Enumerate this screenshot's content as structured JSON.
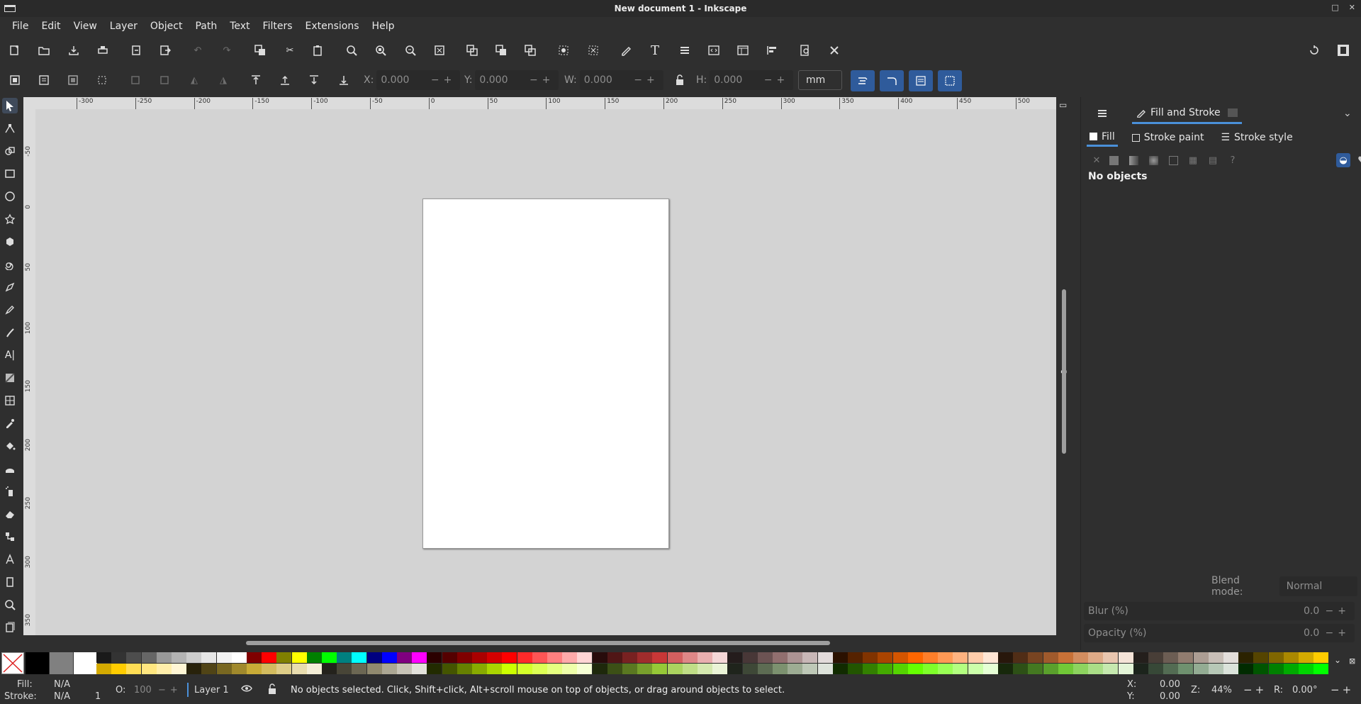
{
  "window": {
    "title": "New document 1 - Inkscape"
  },
  "menu": [
    "File",
    "Edit",
    "View",
    "Layer",
    "Object",
    "Path",
    "Text",
    "Filters",
    "Extensions",
    "Help"
  ],
  "commands_icons": [
    "new-document-icon",
    "open-icon",
    "save-icon",
    "print-icon",
    "import-icon",
    "export-icon",
    "undo-icon",
    "redo-icon",
    "copy-icon",
    "cut-icon",
    "paste-icon",
    "zoom-selection-icon",
    "zoom-drawing-icon",
    "zoom-page-icon",
    "zoom-page-width-icon",
    "duplicate-icon",
    "clone-icon",
    "unlink-clone-icon",
    "group-icon",
    "ungroup-icon",
    "fill-stroke-icon",
    "text-font-icon",
    "layers-icon",
    "xml-editor-icon",
    "document-properties-icon",
    "align-distribute-icon",
    "print-preview-icon",
    "preferences-icon"
  ],
  "select_toolbar": {
    "x_label": "X:",
    "x_value": "0.000",
    "y_label": "Y:",
    "y_value": "0.000",
    "w_label": "W:",
    "w_value": "0.000",
    "h_label": "H:",
    "h_value": "0.000",
    "unit": "mm"
  },
  "tools": [
    "selector",
    "node",
    "shape-builder",
    "rectangle",
    "ellipse",
    "star",
    "3d-box",
    "spiral",
    "bezier",
    "pencil",
    "calligraphy",
    "text",
    "gradient",
    "mesh",
    "dropper",
    "paint-bucket",
    "tweak",
    "spray",
    "eraser",
    "connector",
    "measure",
    "zoom",
    "pages"
  ],
  "ruler": {
    "h_labels": [
      "-300",
      "-250",
      "-200",
      "-150",
      "-100",
      "-50",
      "0",
      "50",
      "100",
      "150",
      "200",
      "250",
      "300",
      "350",
      "400",
      "450",
      "500"
    ],
    "v_labels": [
      "-50",
      "0",
      "50",
      "100",
      "150",
      "200",
      "250",
      "300",
      "350"
    ]
  },
  "dock": {
    "panel_title": "Fill and Stroke",
    "tabs": {
      "fill": "Fill",
      "stroke_paint": "Stroke paint",
      "stroke_style": "Stroke style"
    },
    "no_objects": "No objects",
    "blend_label": "Blend mode:",
    "blend_value": "Normal",
    "blur_label": "Blur (%)",
    "blur_value": "0.0",
    "opacity_label": "Opacity (%)",
    "opacity_value": "0.0"
  },
  "palette": {
    "row1": [
      "#000000",
      "#808080",
      "#ffffff",
      "#1a1a1a",
      "#333333",
      "#4d4d4d",
      "#666666",
      "#999999",
      "#b3b3b3",
      "#cccccc",
      "#e6e6e6",
      "#f2f2f2",
      "#ffffff",
      "#800000",
      "#ff0000",
      "#808000",
      "#ffff00",
      "#008000",
      "#00ff00",
      "#008080",
      "#00ffff",
      "#000080",
      "#0000ff",
      "#800080",
      "#ff00ff",
      "#2b0000",
      "#550000",
      "#800000",
      "#aa0000",
      "#d40000",
      "#ff0000",
      "#ff2a2a",
      "#ff5555",
      "#ff8080",
      "#ffaaaa",
      "#ffd5d5",
      "#280b0b",
      "#501616",
      "#782121",
      "#a02c2c",
      "#c83737",
      "#d35f5f",
      "#de8787",
      "#e9afaf",
      "#f4d7d7",
      "#241c1c",
      "#483737",
      "#6c5353",
      "#916f6f",
      "#ac9393",
      "#c8b7b7",
      "#e3dbdb",
      "#2b1100",
      "#552200",
      "#803300",
      "#aa4400",
      "#d45500",
      "#ff6600",
      "#ff7f2a",
      "#ff9955",
      "#ffb380",
      "#ffccaa",
      "#ffe6d5",
      "#28170b",
      "#502d16",
      "#784421",
      "#a05a2c",
      "#c87137",
      "#d38d5f",
      "#deaa87",
      "#e9c6af",
      "#f4e3d7",
      "#241f1c",
      "#483e37",
      "#6c5d53",
      "#917c6f",
      "#ac9d93",
      "#c8beb7",
      "#e3dedb",
      "#2b2200",
      "#554400",
      "#806600",
      "#aa8800",
      "#d4aa00",
      "#ffcc00"
    ],
    "row2": [
      "#d4aa00",
      "#ffcc00",
      "#ffdd55",
      "#ffe680",
      "#ffeeaa",
      "#fff6d5",
      "#28220b",
      "#504416",
      "#786721",
      "#a0892c",
      "#c8ab37",
      "#d3bc5f",
      "#decd87",
      "#e9ddaf",
      "#f4eed7",
      "#24221c",
      "#484537",
      "#6c6753",
      "#918a6f",
      "#aca793",
      "#c8c4b7",
      "#e3e2db",
      "#222b00",
      "#445500",
      "#668000",
      "#88aa00",
      "#aad400",
      "#ccff00",
      "#d4ff2a",
      "#ddff55",
      "#e5ff80",
      "#eeffaa",
      "#f6ffd5",
      "#1e280b",
      "#3c5016",
      "#5a7821",
      "#78a02c",
      "#96c837",
      "#abd35f",
      "#c0de87",
      "#d5e9af",
      "#eaf4d7",
      "#1f241c",
      "#3e4837",
      "#5d6c53",
      "#7c916f",
      "#9dac93",
      "#bec8b7",
      "#dee3db",
      "#112b00",
      "#225500",
      "#338000",
      "#44aa00",
      "#55d400",
      "#66ff00",
      "#7fff2a",
      "#99ff55",
      "#b3ff80",
      "#ccffaa",
      "#e5ffd5",
      "#17280b",
      "#2d5016",
      "#447821",
      "#5aa02c",
      "#71c837",
      "#8dd35f",
      "#aade87",
      "#c6e9af",
      "#e3f4d7",
      "#1c241c",
      "#374837",
      "#536c53",
      "#6f916f",
      "#93ac93",
      "#b7c8b7",
      "#dbe3db",
      "#002b00",
      "#005500",
      "#008000",
      "#00aa00",
      "#00d400",
      "#00ff00"
    ]
  },
  "status": {
    "fill_label": "Fill:",
    "fill_value": "N/A",
    "stroke_label": "Stroke:",
    "stroke_value": "N/A",
    "stroke_width": "1",
    "opacity_label": "O:",
    "opacity_value": "100",
    "layer": "Layer 1",
    "message": "No objects selected. Click, Shift+click, Alt+scroll mouse on top of objects, or drag around objects to select.",
    "x_label": "X:",
    "x_value": "0.00",
    "y_label": "Y:",
    "y_value": "0.00",
    "zoom_label": "Z:",
    "zoom_value": "44%",
    "rotate_label": "R:",
    "rotate_value": "0.00°"
  }
}
